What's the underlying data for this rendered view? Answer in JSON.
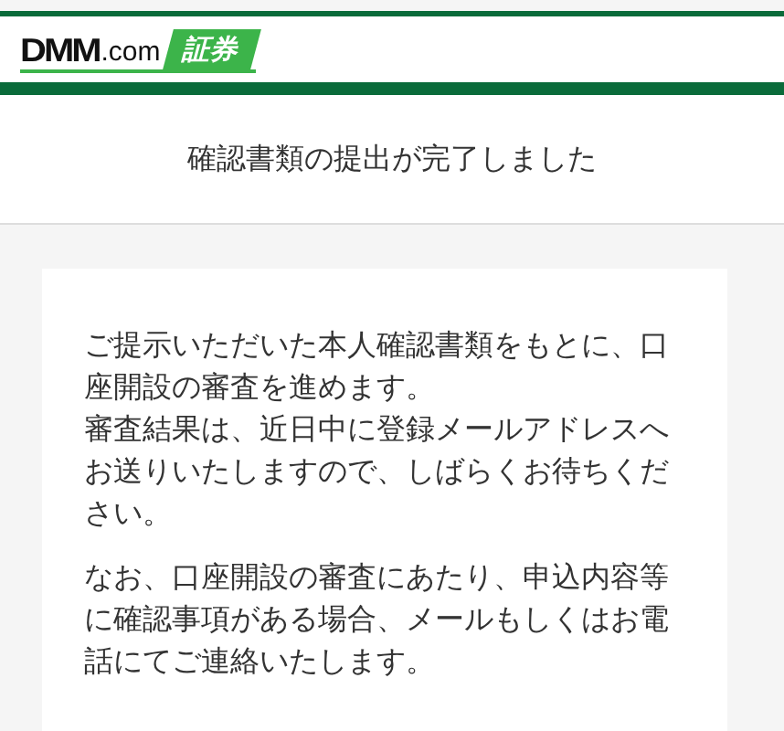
{
  "header": {
    "logo": {
      "brand": "DMM",
      "domain": ".com",
      "badge": "証券"
    }
  },
  "title": "確認書類の提出が完了しました",
  "paragraphs": [
    [
      "ご提示いただいた本人確認書類をもとに、口座開設の審査を進めます。",
      "審査結果は、近日中に登録メールアドレスへお送りいたしますので、しばらくお待ちください。"
    ],
    [
      "なお、口座開設の審査にあたり、申込内容等に確認事項がある場合、メールもしくはお電話にてご連絡いたします。"
    ]
  ]
}
